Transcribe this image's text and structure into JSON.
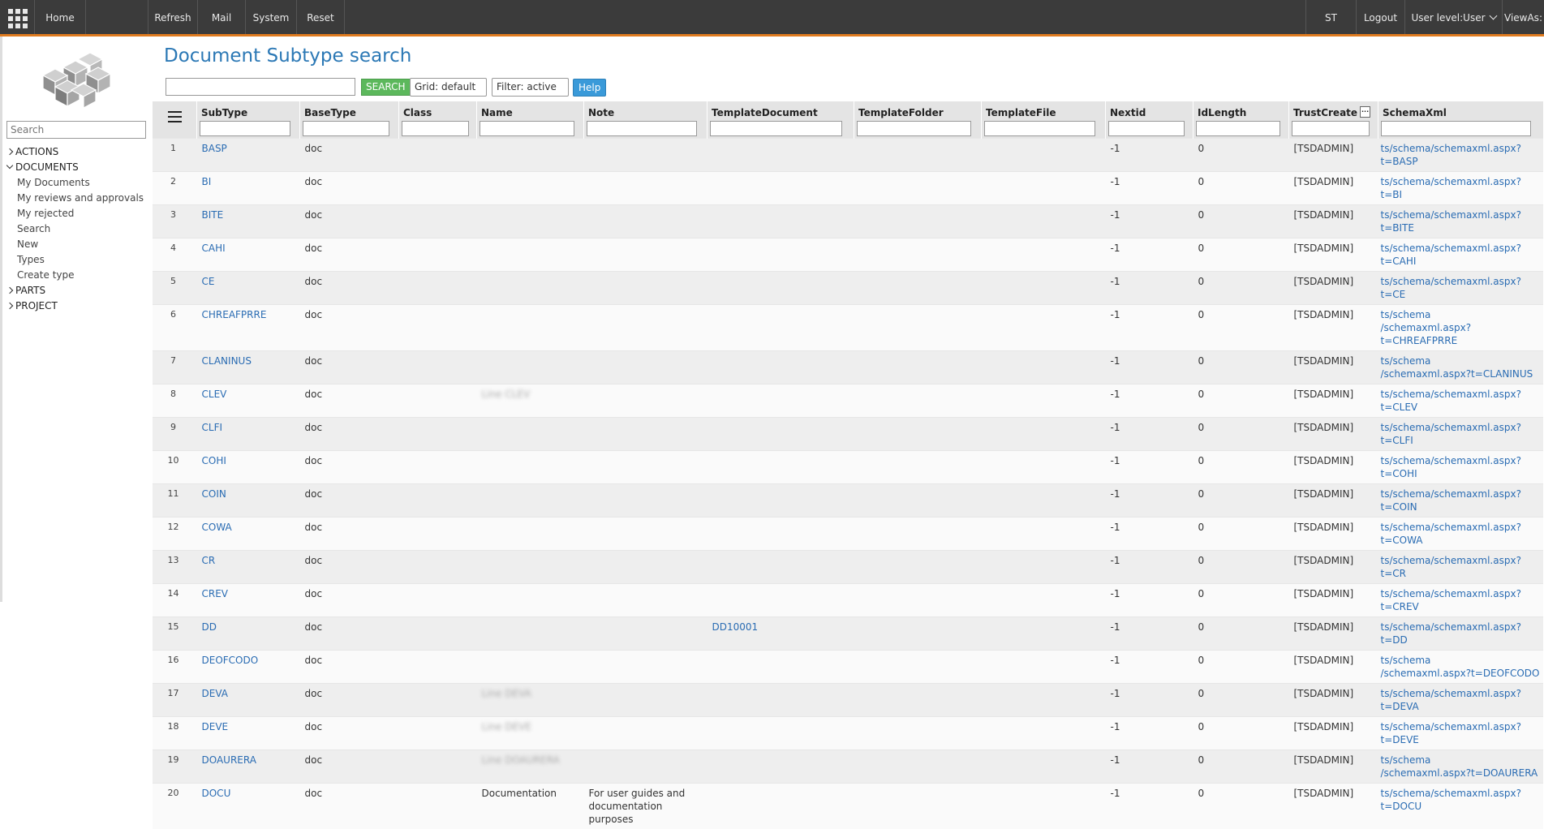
{
  "topbar": {
    "home": "Home",
    "refresh": "Refresh",
    "mail": "Mail",
    "system": "System",
    "reset": "Reset",
    "user_initials": "ST",
    "logout": "Logout",
    "user_level": "User level:User",
    "view_as": "ViewAs:"
  },
  "sidebar": {
    "search_placeholder": "Search",
    "tree": [
      {
        "label": "ACTIONS",
        "expanded": false
      },
      {
        "label": "DOCUMENTS",
        "expanded": true,
        "children": [
          "My Documents",
          "My reviews and approvals",
          "My rejected",
          "Search",
          "New",
          "Types",
          "Create type"
        ]
      },
      {
        "label": "PARTS",
        "expanded": false
      },
      {
        "label": "PROJECT",
        "expanded": false
      }
    ]
  },
  "page": {
    "title": "Document Subtype search",
    "search_button": "SEARCH",
    "grid_select": "Grid: default",
    "filter_select": "Filter: active",
    "help_button": "Help"
  },
  "table": {
    "columns": [
      "SubType",
      "BaseType",
      "Class",
      "Name",
      "Note",
      "TemplateDocument",
      "TemplateFolder",
      "TemplateFile",
      "Nextid",
      "IdLength",
      "TrustCreate",
      "SchemaXml"
    ],
    "trustcreate_button": "...",
    "rows": [
      {
        "n": "1",
        "subtype": "BASP",
        "basetype": "doc",
        "name": "",
        "name_blur": false,
        "note": "",
        "tdoc": "",
        "nextid": "-1",
        "idlength": "0",
        "trust": "[TSDADMIN]",
        "schema1": "ts/schema/schemaxml.aspx?t=BASP",
        "schema2": ""
      },
      {
        "n": "2",
        "subtype": "BI",
        "basetype": "doc",
        "name": "",
        "name_blur": false,
        "note": "",
        "tdoc": "",
        "nextid": "-1",
        "idlength": "0",
        "trust": "[TSDADMIN]",
        "schema1": "ts/schema/schemaxml.aspx?t=BI",
        "schema2": ""
      },
      {
        "n": "3",
        "subtype": "BITE",
        "basetype": "doc",
        "name": "",
        "name_blur": false,
        "note": "",
        "tdoc": "",
        "nextid": "-1",
        "idlength": "0",
        "trust": "[TSDADMIN]",
        "schema1": "ts/schema/schemaxml.aspx?t=BITE",
        "schema2": ""
      },
      {
        "n": "4",
        "subtype": "CAHI",
        "basetype": "doc",
        "name": "",
        "name_blur": false,
        "note": "",
        "tdoc": "",
        "nextid": "-1",
        "idlength": "0",
        "trust": "[TSDADMIN]",
        "schema1": "ts/schema/schemaxml.aspx?t=CAHI",
        "schema2": ""
      },
      {
        "n": "5",
        "subtype": "CE",
        "basetype": "doc",
        "name": "",
        "name_blur": false,
        "note": "",
        "tdoc": "",
        "nextid": "-1",
        "idlength": "0",
        "trust": "[TSDADMIN]",
        "schema1": "ts/schema/schemaxml.aspx?t=CE",
        "schema2": ""
      },
      {
        "n": "6",
        "subtype": "CHREAFPRRE",
        "basetype": "doc",
        "name": "",
        "name_blur": false,
        "note": "",
        "tdoc": "",
        "nextid": "-1",
        "idlength": "0",
        "trust": "[TSDADMIN]",
        "schema1": "ts/schema",
        "schema2": "/schemaxml.aspx?t=CHREAFPRRE"
      },
      {
        "n": "7",
        "subtype": "CLANINUS",
        "basetype": "doc",
        "name": "",
        "name_blur": false,
        "note": "",
        "tdoc": "",
        "nextid": "-1",
        "idlength": "0",
        "trust": "[TSDADMIN]",
        "schema1": "ts/schema",
        "schema2": "/schemaxml.aspx?t=CLANINUS"
      },
      {
        "n": "8",
        "subtype": "CLEV",
        "basetype": "doc",
        "name": "Line CLEV",
        "name_blur": true,
        "note": "",
        "tdoc": "",
        "nextid": "-1",
        "idlength": "0",
        "trust": "[TSDADMIN]",
        "schema1": "ts/schema/schemaxml.aspx?t=CLEV",
        "schema2": ""
      },
      {
        "n": "9",
        "subtype": "CLFI",
        "basetype": "doc",
        "name": "",
        "name_blur": false,
        "note": "",
        "tdoc": "",
        "nextid": "-1",
        "idlength": "0",
        "trust": "[TSDADMIN]",
        "schema1": "ts/schema/schemaxml.aspx?t=CLFI",
        "schema2": ""
      },
      {
        "n": "10",
        "subtype": "COHI",
        "basetype": "doc",
        "name": "",
        "name_blur": false,
        "note": "",
        "tdoc": "",
        "nextid": "-1",
        "idlength": "0",
        "trust": "[TSDADMIN]",
        "schema1": "ts/schema/schemaxml.aspx?t=COHI",
        "schema2": ""
      },
      {
        "n": "11",
        "subtype": "COIN",
        "basetype": "doc",
        "name": "",
        "name_blur": false,
        "note": "",
        "tdoc": "",
        "nextid": "-1",
        "idlength": "0",
        "trust": "[TSDADMIN]",
        "schema1": "ts/schema/schemaxml.aspx?t=COIN",
        "schema2": ""
      },
      {
        "n": "12",
        "subtype": "COWA",
        "basetype": "doc",
        "name": "",
        "name_blur": false,
        "note": "",
        "tdoc": "",
        "nextid": "-1",
        "idlength": "0",
        "trust": "[TSDADMIN]",
        "schema1": "ts/schema/schemaxml.aspx?t=COWA",
        "schema2": ""
      },
      {
        "n": "13",
        "subtype": "CR",
        "basetype": "doc",
        "name": "",
        "name_blur": false,
        "note": "",
        "tdoc": "",
        "nextid": "-1",
        "idlength": "0",
        "trust": "[TSDADMIN]",
        "schema1": "ts/schema/schemaxml.aspx?t=CR",
        "schema2": ""
      },
      {
        "n": "14",
        "subtype": "CREV",
        "basetype": "doc",
        "name": "",
        "name_blur": false,
        "note": "",
        "tdoc": "",
        "nextid": "-1",
        "idlength": "0",
        "trust": "[TSDADMIN]",
        "schema1": "ts/schema/schemaxml.aspx?t=CREV",
        "schema2": ""
      },
      {
        "n": "15",
        "subtype": "DD",
        "basetype": "doc",
        "name": "",
        "name_blur": false,
        "note": "",
        "tdoc": "DD10001",
        "nextid": "-1",
        "idlength": "0",
        "trust": "[TSDADMIN]",
        "schema1": "ts/schema/schemaxml.aspx?t=DD",
        "schema2": ""
      },
      {
        "n": "16",
        "subtype": "DEOFCODO",
        "basetype": "doc",
        "name": "",
        "name_blur": false,
        "note": "",
        "tdoc": "",
        "nextid": "-1",
        "idlength": "0",
        "trust": "[TSDADMIN]",
        "schema1": "ts/schema",
        "schema2": "/schemaxml.aspx?t=DEOFCODO"
      },
      {
        "n": "17",
        "subtype": "DEVA",
        "basetype": "doc",
        "name": "Line DEVA",
        "name_blur": true,
        "note": "",
        "tdoc": "",
        "nextid": "-1",
        "idlength": "0",
        "trust": "[TSDADMIN]",
        "schema1": "ts/schema/schemaxml.aspx?t=DEVA",
        "schema2": ""
      },
      {
        "n": "18",
        "subtype": "DEVE",
        "basetype": "doc",
        "name": "Line DEVE",
        "name_blur": true,
        "note": "",
        "tdoc": "",
        "nextid": "-1",
        "idlength": "0",
        "trust": "[TSDADMIN]",
        "schema1": "ts/schema/schemaxml.aspx?t=DEVE",
        "schema2": ""
      },
      {
        "n": "19",
        "subtype": "DOAURERA",
        "basetype": "doc",
        "name": "Line DOAURERA",
        "name_blur": true,
        "note": "",
        "tdoc": "",
        "nextid": "-1",
        "idlength": "0",
        "trust": "[TSDADMIN]",
        "schema1": "ts/schema",
        "schema2": "/schemaxml.aspx?t=DOAURERA"
      },
      {
        "n": "20",
        "subtype": "DOCU",
        "basetype": "doc",
        "name": "Documentation",
        "name_blur": false,
        "note": "For user guides and documentation purposes",
        "tdoc": "",
        "nextid": "-1",
        "idlength": "0",
        "trust": "[TSDADMIN]",
        "schema1": "ts/schema/schemaxml.aspx?t=DOCU",
        "schema2": ""
      }
    ]
  }
}
